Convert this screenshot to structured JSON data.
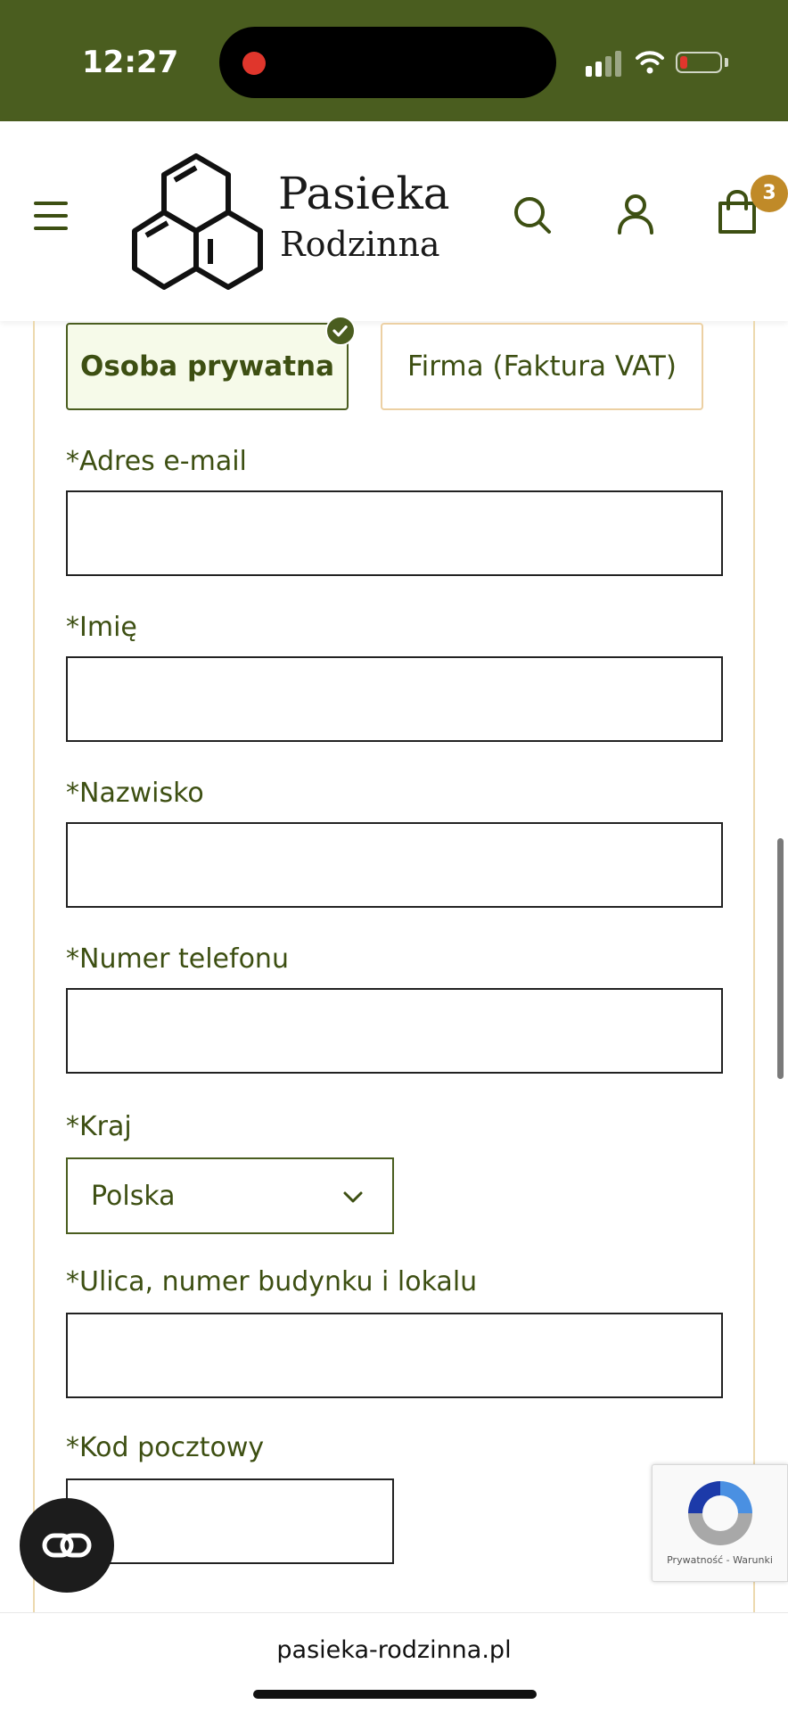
{
  "status_bar": {
    "time": "12:27"
  },
  "header": {
    "logo_title": "Pasieka",
    "logo_subtitle": "Rodzinna",
    "cart_count": "3"
  },
  "customer_type": {
    "options": [
      {
        "label": "Osoba prywatna",
        "selected": true
      },
      {
        "label": "Firma (Faktura VAT)",
        "selected": false
      }
    ]
  },
  "form": {
    "email_label": "*Adres e-mail",
    "first_name_label": "*Imię",
    "last_name_label": "*Nazwisko",
    "phone_label": "*Numer telefonu",
    "country_label": "*Kraj",
    "country_value": "Polska",
    "street_label": "*Ulica, numer budynku i lokalu",
    "postal_label": "*Kod pocztowy"
  },
  "recaptcha": {
    "links": "Prywatność - Warunki"
  },
  "browser": {
    "url": "pasieka-rodzinna.pl"
  },
  "colors": {
    "brand_green": "#4a5d1f",
    "accent_gold": "#c08a28",
    "border_beige": "#ecd9ae"
  }
}
